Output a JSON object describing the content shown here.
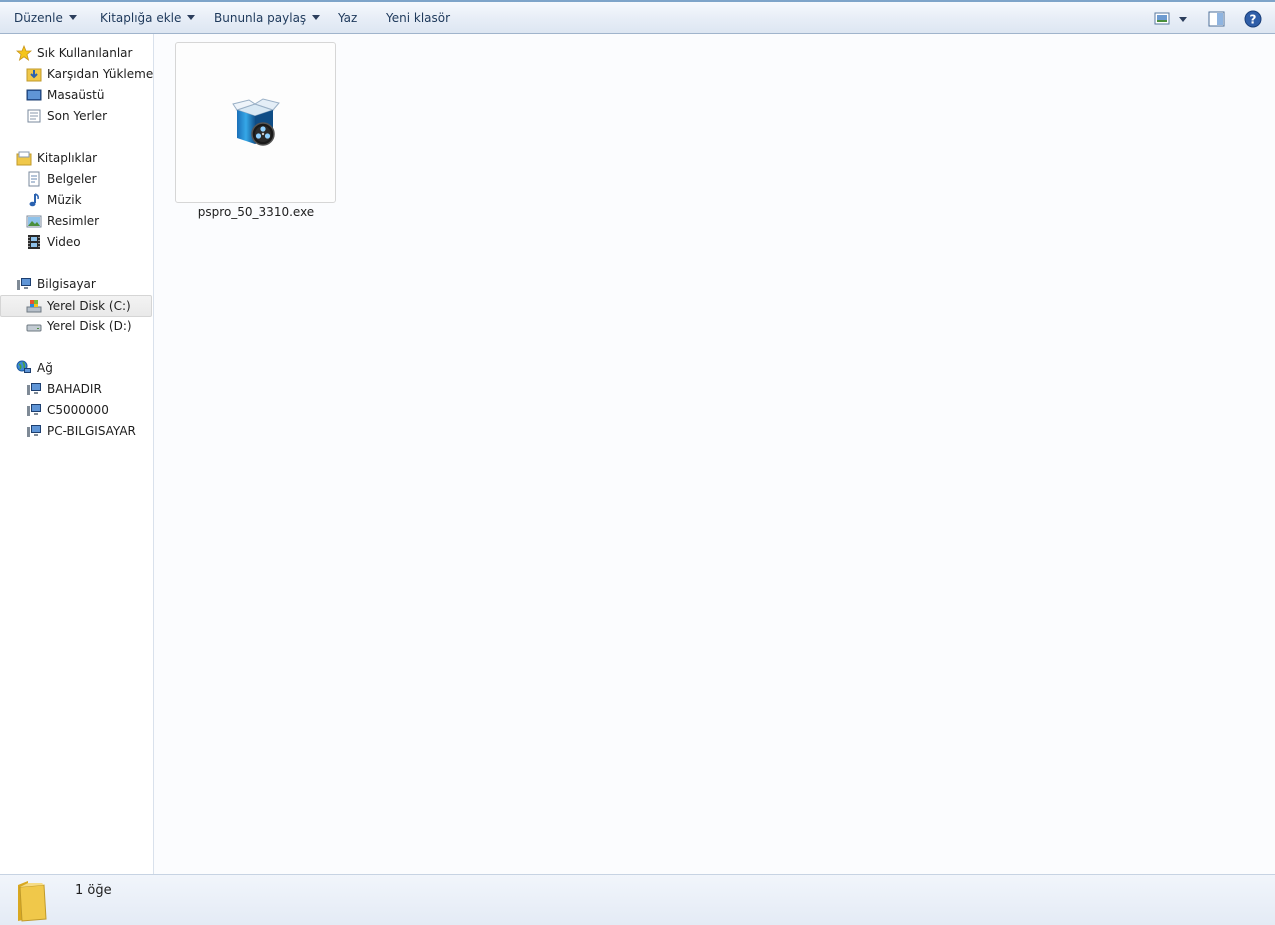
{
  "toolbar": {
    "organize": "Düzenle",
    "add_to_library": "Kitaplığa ekle",
    "share_with": "Bununla paylaş",
    "burn": "Yaz",
    "new_folder": "Yeni klasör"
  },
  "sidebar": {
    "favorites": {
      "label": "Sık Kullanılanlar",
      "items": [
        "Karşıdan Yüklemeler",
        "Masaüstü",
        "Son Yerler"
      ]
    },
    "libraries": {
      "label": "Kitaplıklar",
      "items": [
        "Belgeler",
        "Müzik",
        "Resimler",
        "Video"
      ]
    },
    "computer": {
      "label": "Bilgisayar",
      "items": [
        "Yerel Disk (C:)",
        "Yerel Disk (D:)"
      ],
      "selected": "Yerel Disk (C:)"
    },
    "network": {
      "label": "Ağ",
      "items": [
        "BAHADIR",
        "C5000000",
        "PC-BILGISAYAR"
      ]
    }
  },
  "files": [
    {
      "name": "pspro_50_3310.exe",
      "icon": "installer-box-icon"
    }
  ],
  "status": {
    "item_count": "1 öğe",
    "icon": "folder-icon"
  },
  "colors": {
    "toolbar_bg": "#e8eef7",
    "selection_bg": "#e9e9e9",
    "folder_yellow": "#f0c84a"
  }
}
